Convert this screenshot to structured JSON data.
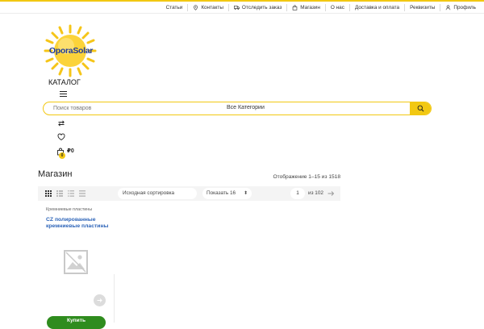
{
  "topnav": {
    "items": [
      {
        "label": "Статьи",
        "icon": ""
      },
      {
        "label": "Контакты",
        "icon": "location-pin-icon"
      },
      {
        "label": "Отследить заказ",
        "icon": "truck-icon"
      },
      {
        "label": "Магазин",
        "icon": "shopping-bag-icon"
      },
      {
        "label": "О нас",
        "icon": ""
      },
      {
        "label": "Доставка и оплата",
        "icon": ""
      },
      {
        "label": "Реквизиты",
        "icon": ""
      },
      {
        "label": "Профиль",
        "icon": "user-icon"
      }
    ]
  },
  "logo": {
    "text": "OporaSolar"
  },
  "catalog": {
    "label": "КАТАЛОГ"
  },
  "search": {
    "placeholder": "Поиск товаров",
    "category": "Все Категории"
  },
  "cart": {
    "count": "0",
    "total": "₽0"
  },
  "shop": {
    "title": "Магазин",
    "result_count": "Отображение 1–15 из 1518",
    "sort_label": "Исходная сортировка",
    "per_page_label": "Показать 16",
    "page_current": "1",
    "page_of": "из 102"
  },
  "product": {
    "category": "Кремниевые пластины",
    "name": "CZ полированные кремниевые пластины",
    "buy_label": "Купить"
  },
  "colors": {
    "accent": "#f2c812",
    "link": "#2d64b8",
    "buy": "#2f8c1e"
  }
}
